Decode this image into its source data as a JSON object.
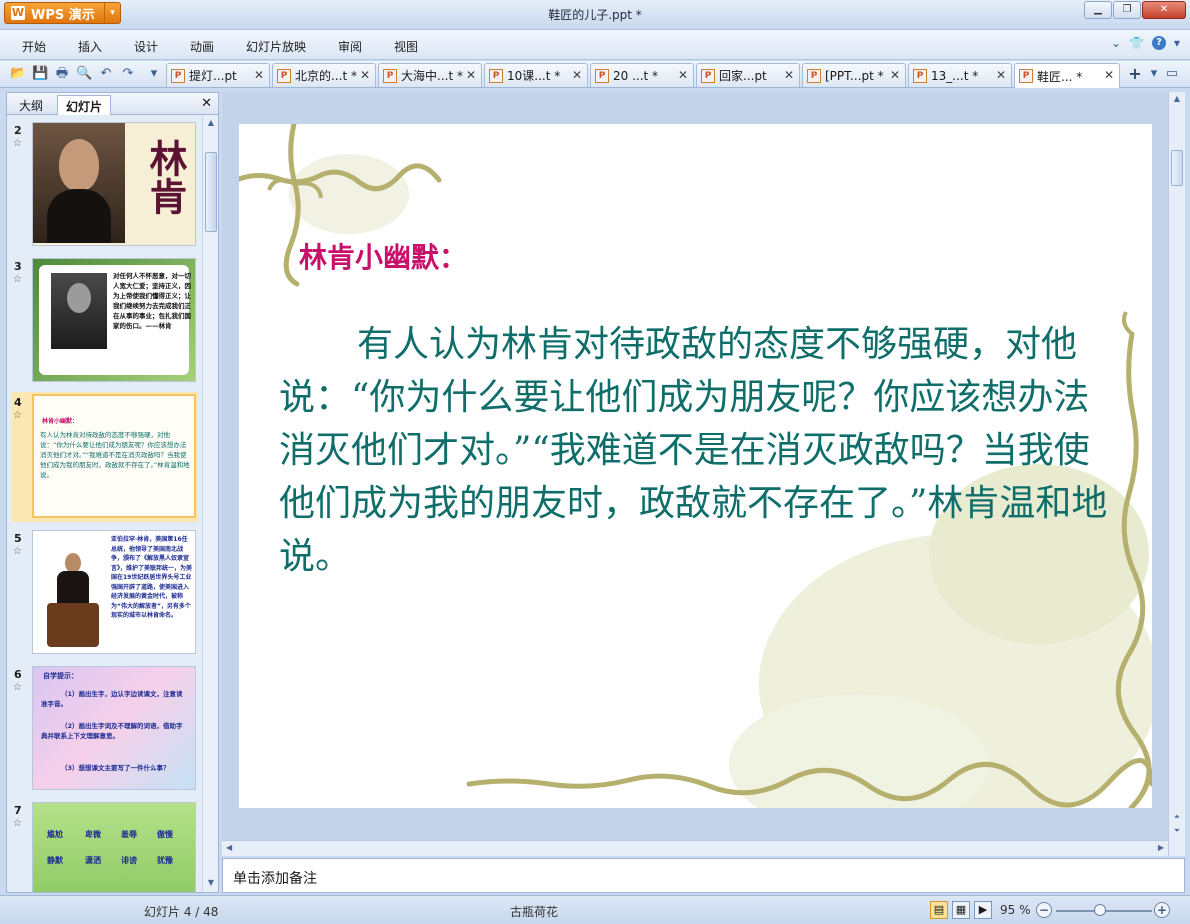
{
  "app": {
    "name": "WPS 演示",
    "logo_glyph": "W"
  },
  "window": {
    "title": "鞋匠的儿子.ppt *"
  },
  "menu": {
    "items": [
      "开始",
      "插入",
      "设计",
      "动画",
      "幻灯片放映",
      "审阅",
      "视图"
    ]
  },
  "tabs": [
    {
      "label": "提灯...pt",
      "active": false
    },
    {
      "label": "北京的...t *",
      "active": false
    },
    {
      "label": "大海中...t *",
      "active": false
    },
    {
      "label": "10课...t *",
      "active": false
    },
    {
      "label": "20 ...t *",
      "active": false
    },
    {
      "label": "回家...pt",
      "active": false
    },
    {
      "label": "[PPT...pt *",
      "active": false
    },
    {
      "label": "13_...t *",
      "active": false
    },
    {
      "label": "鞋匠... *",
      "active": true
    }
  ],
  "left_panel": {
    "tab_outline": "大纲",
    "tab_slides": "幻灯片",
    "thumbnails": [
      {
        "num": "2",
        "title": "林肯"
      },
      {
        "num": "3",
        "text": "对任何人不怀恶意，对一切人宽大仁爱；坚持正义，因为上帝使我们懂得正义；让我们继续努力去完成我们正在从事的事业；包扎我们国家的伤口。——林肯"
      },
      {
        "num": "4",
        "heading": "林肯小幽默：",
        "text": "有人认为林肯对待政敌的态度不够强硬，对他说：“你为什么要让他们成为朋友呢？你应该想办法消灭他们才对。”“我难道不是在消灭政敌吗？当我使他们成为我的朋友时，政敌就不存在了。”林肯温和地说。"
      },
      {
        "num": "5",
        "text": "亚伯拉罕·林肯，美国第16任总统，他领导了美国南北战争，颁布了《解放黑人奴隶宣言》，维护了美联邦统一，为美国在19世纪跃居世界头号工业强国开辟了道路，使美国进入经济发展的黄金时代，被称为“伟大的解放者”，另有多个现实的城市以林肯命名。"
      },
      {
        "num": "6",
        "heading": "自学提示：",
        "items": [
          "（1）画出生字，边认字边读课文，注意读准字音。",
          "（2）画出生字词及不理解的词语，借助字典并联系上下文理解意思。",
          "（3）想想课文主要写了一件什么事？"
        ]
      },
      {
        "num": "7",
        "words": [
          "尴尬",
          "卑微",
          "羞辱",
          "傲慢",
          "静默",
          "潇洒",
          "诽谤",
          "犹豫"
        ]
      }
    ]
  },
  "slide": {
    "title": "林肯小幽默：",
    "body": "有人认为林肯对待政敌的态度不够强硬，对他说：“你为什么要让他们成为朋友呢？你应该想办法消灭他们才对。”“我难道不是在消灭政敌吗？当我使他们成为我的朋友时，政敌就不存在了。”林肯温和地说。"
  },
  "notes": {
    "placeholder": "单击添加备注"
  },
  "status": {
    "slide_counter": "幻灯片 4 / 48",
    "theme": "古瓶荷花",
    "zoom": "95 %"
  },
  "colors": {
    "accent": "#e0750c",
    "slide_title": "#c8116b",
    "slide_body": "#0f6d6a"
  }
}
